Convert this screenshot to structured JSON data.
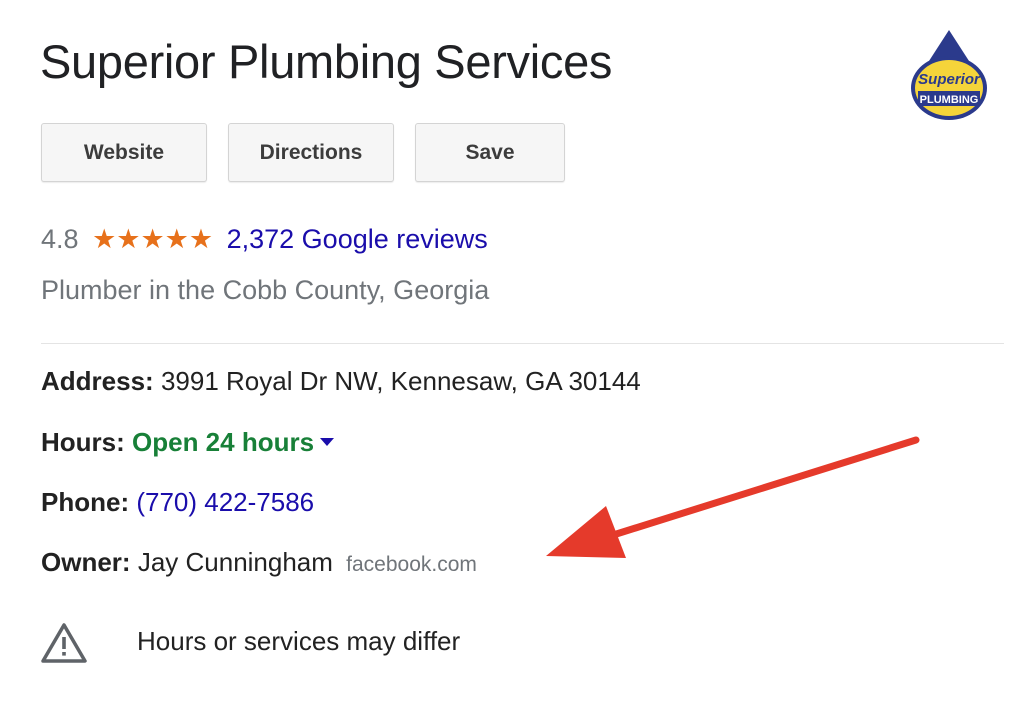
{
  "business": {
    "name": "Superior Plumbing Services",
    "logo": {
      "line1": "Superior",
      "line2": "PLUMBING"
    }
  },
  "actions": {
    "website_label": "Website",
    "directions_label": "Directions",
    "save_label": "Save"
  },
  "rating": {
    "value": "4.8",
    "stars": "★★★★★",
    "reviews_label": "2,372 Google reviews"
  },
  "category": "Plumber in the Cobb County, Georgia",
  "details": {
    "address_label": "Address:",
    "address_value": "3991 Royal Dr NW, Kennesaw, GA 30144",
    "hours_label": "Hours:",
    "hours_value": "Open 24 hours",
    "phone_label": "Phone:",
    "phone_value": "(770) 422-7586",
    "owner_label": "Owner:",
    "owner_value": "Jay Cunningham",
    "owner_source": "facebook.com"
  },
  "notice": {
    "text": "Hours or services may differ"
  },
  "colors": {
    "link": "#1a0dab",
    "open_green": "#188038",
    "star_orange": "#e7711b",
    "annotation_red": "#e53a2b",
    "logo_blue": "#2b3a8c",
    "logo_yellow": "#f5d43a"
  },
  "icons": {
    "warning": "warning-triangle-icon",
    "dropdown": "caret-down-icon"
  }
}
